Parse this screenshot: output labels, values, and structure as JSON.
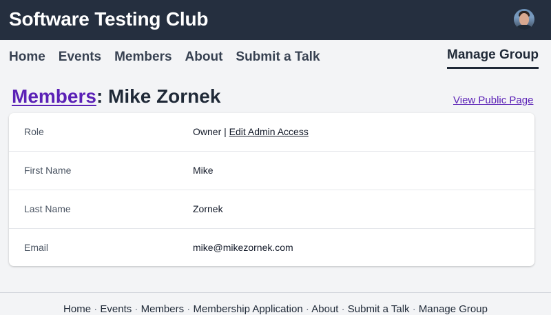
{
  "header": {
    "site_title": "Software Testing Club"
  },
  "nav": {
    "items": [
      "Home",
      "Events",
      "Members",
      "About",
      "Submit a Talk"
    ],
    "manage_group": "Manage Group"
  },
  "page": {
    "breadcrumb_link": "Members",
    "title_suffix": ": Mike Zornek",
    "view_public_page": "View Public Page"
  },
  "details": {
    "rows": [
      {
        "label": "Role",
        "value": "Owner | ",
        "link": "Edit Admin Access"
      },
      {
        "label": "First Name",
        "value": "Mike"
      },
      {
        "label": "Last Name",
        "value": "Zornek"
      },
      {
        "label": "Email",
        "value": "mike@mikezornek.com"
      }
    ]
  },
  "footer": {
    "links": [
      "Home",
      "Events",
      "Members",
      "Membership Application",
      "About",
      "Submit a Talk",
      "Manage Group"
    ],
    "separator": "·"
  },
  "colors": {
    "header_bg": "#252f3f",
    "page_bg": "#f3f4f6",
    "link_purple": "#5b21b6"
  },
  "icons": {
    "avatar": "user-avatar-photo"
  }
}
